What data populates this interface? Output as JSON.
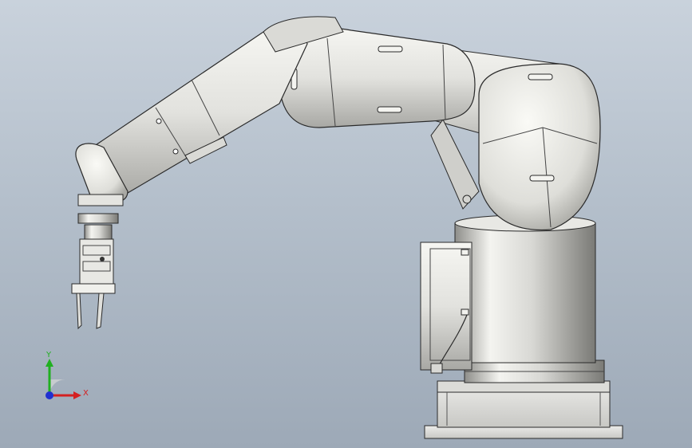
{
  "viewport": {
    "background_top": "#c9d2dc",
    "background_bottom": "#9da9b7"
  },
  "triad": {
    "x_label": "X",
    "y_label": "Y",
    "x_color": "#d42020",
    "y_color": "#20b020",
    "z_color": "#2030d0"
  },
  "model": {
    "body_color": "#e6e6e2",
    "edge_color": "#2a2a2a"
  }
}
